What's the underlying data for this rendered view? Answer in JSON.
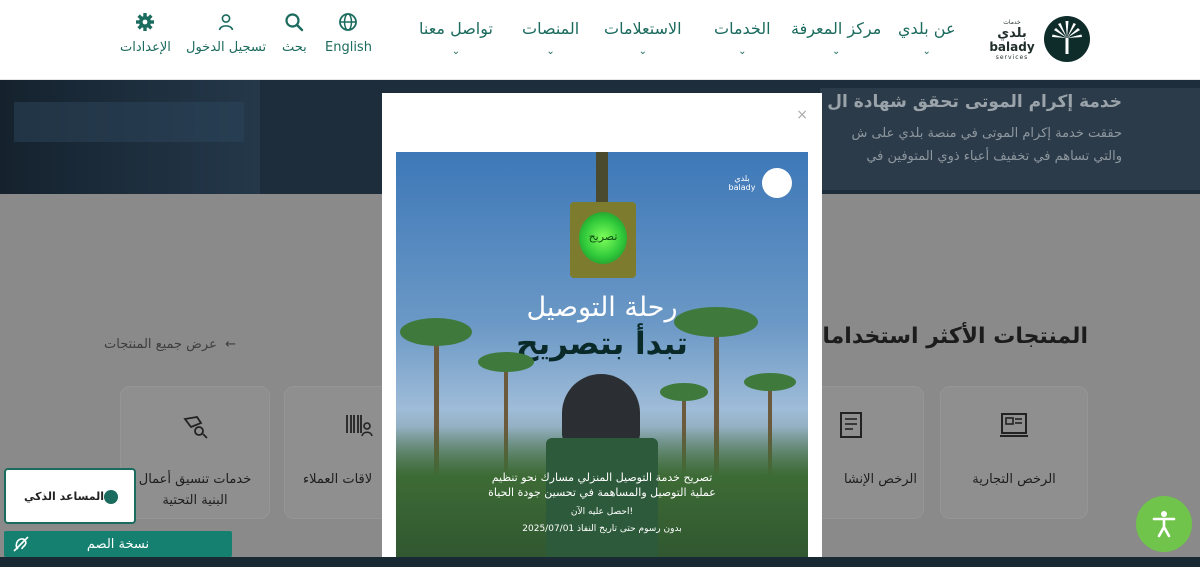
{
  "header": {
    "logo": {
      "arabic": "بلدي",
      "name": "balady",
      "subtitle": "services",
      "small": "خدمات"
    },
    "nav": [
      {
        "label": "عن بلدي"
      },
      {
        "label": "مركز المعرفة"
      },
      {
        "label": "الخدمات"
      },
      {
        "label": "الاستعلامات"
      },
      {
        "label": "المنصات"
      },
      {
        "label": "تواصل معنا"
      }
    ],
    "tools": {
      "language": "English",
      "search": "بحث",
      "login": "تسجيل الدخول",
      "settings": "الإعدادات"
    }
  },
  "hero": {
    "title": "خدمة إكرام الموتى تحقق شهادة ال",
    "line1": "حققت خدمة إكرام الموتى في منصة بلدي على ش",
    "line2": "والتي تساهم في تخفيف أعباء ذوي المتوفين في"
  },
  "products": {
    "title": "المنتجات الأكثر استخداما",
    "view_all": "عرض جميع المنتجات",
    "cards": [
      {
        "label": "الرخص التجارية"
      },
      {
        "label": "الرخص الإنشا"
      },
      {
        "label": "لاقات العملاء"
      },
      {
        "label": "خدمات تنسيق أعمال البنية التحتية"
      }
    ]
  },
  "modal": {
    "close": "×",
    "poster": {
      "light_text": "تصريح",
      "logo_text": "بلدي",
      "logo_sub": "balady",
      "headline1": "رحلة التوصيل",
      "headline2": "تبدأ بتصريح",
      "body_line1": "تصريح خدمة التوصيل المنزلي مسارك نحو تنظيم",
      "body_line2": "عملية التوصيل والمساهمة في تحسين جودة الحياة",
      "cta": "احصل عليه الآن!",
      "footer": "بدون رسوم حتى تاريخ النفاذ 2025/07/01"
    }
  },
  "widgets": {
    "assistant": "المساعد الذكي",
    "deaf_version": "نسخة الصم"
  },
  "colors": {
    "brand": "#1b6b5e",
    "accessibility": "#70c44b"
  }
}
